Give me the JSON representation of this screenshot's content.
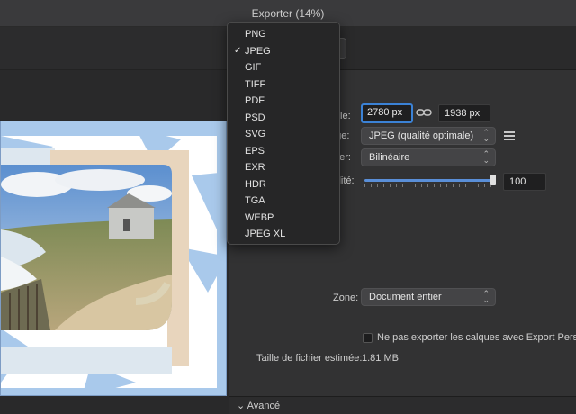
{
  "window": {
    "title": "Exporter (14%)"
  },
  "format_menu": {
    "selected": "JPEG",
    "items": [
      "PNG",
      "JPEG",
      "GIF",
      "TIFF",
      "PDF",
      "PSD",
      "SVG",
      "EPS",
      "EXR",
      "HDR",
      "TGA",
      "WEBP",
      "JPEG XL"
    ]
  },
  "settings": {
    "size_label": "aille:",
    "width_value": "2780 px",
    "height_value": "1938 px",
    "preset_label": "age:",
    "preset_value": "JPEG (qualité optimale)",
    "resample_label": "ner:",
    "resample_value": "Bilinéaire",
    "quality_label": "ilité:",
    "quality_value": "100",
    "quality_level": 1.0,
    "zone_label": "Zone:",
    "zone_value": "Document entier",
    "export_persona_label": "Ne pas exporter les calques avec Export Personas",
    "file_size_label": "Taille de fichier estimée:",
    "file_size_value": "1.81 MB",
    "advanced_label": "⌄ Avancé"
  },
  "colors": {
    "accent": "#3b82d6",
    "panel": "#323233"
  }
}
